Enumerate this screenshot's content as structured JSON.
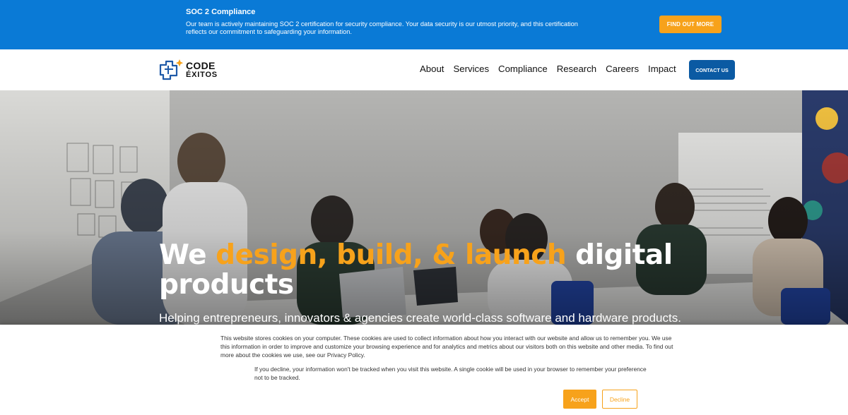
{
  "announcement": {
    "title": "SOC 2 Compliance",
    "text": "Our team is actively maintaining SOC 2 certification for security compliance. Your data security is our utmost priority, and this certification reflects our commitment to safeguarding your information.",
    "button_label": "FIND OUT MORE",
    "background_color": "#0a7ad6",
    "button_color": "#f7a21b"
  },
  "header": {
    "logo": {
      "line1": "CODE",
      "line2": "ÉXITOS"
    },
    "nav": [
      {
        "label": "About"
      },
      {
        "label": "Services"
      },
      {
        "label": "Compliance"
      },
      {
        "label": "Research"
      },
      {
        "label": "Careers"
      },
      {
        "label": "Impact"
      }
    ],
    "contact_label": "CONTACT US",
    "contact_color": "#0b5aa3"
  },
  "hero": {
    "headline_start": "We ",
    "headline_accent": "design, build, & launch",
    "headline_end": " digital products",
    "subheadline": "Helping entrepreneurs, innovators & agencies create world-class software and hardware products.",
    "accent_color": "#f7a21b"
  },
  "cookie": {
    "main_text": "This website stores cookies on your computer. These cookies are used to collect information about how you interact with our website and allow us to remember you. We use this information in order to improve and customize your browsing experience and for analytics and metrics about our visitors both on this website and other media. To find out more about the cookies we use, see our Privacy Policy.",
    "secondary_text": "If you decline, your information won't be tracked when you visit this website. A single cookie will be used in your browser to remember your preference not to be tracked.",
    "accept_label": "Accept",
    "decline_label": "Decline"
  }
}
